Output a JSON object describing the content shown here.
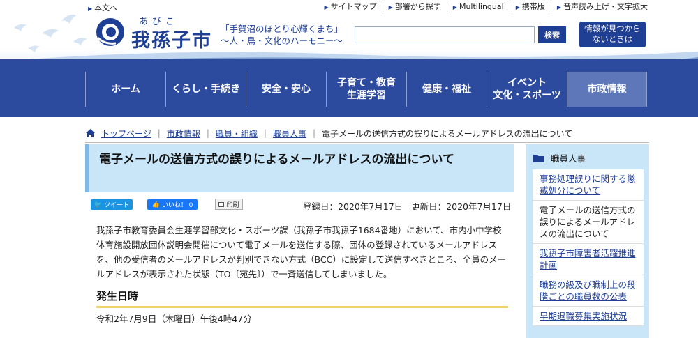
{
  "header": {
    "skip_link": "本文へ",
    "util_links": [
      "サイトマップ",
      "部署から探す",
      "Multilingual",
      "携帯版",
      "音声読み上げ・文字拡大"
    ],
    "logo_ruby": "あびこ",
    "logo_name": "我孫子市",
    "slogan_line1": "「手賀沼のほとり心輝くまち」",
    "slogan_line2": "～人・鳥・文化のハーモニー～",
    "search_value": "",
    "search_button": "検索",
    "help_line1": "情報が見つから",
    "help_line2": "ないときは"
  },
  "nav": [
    {
      "label": "ホーム"
    },
    {
      "label": "くらし・手続き"
    },
    {
      "label": "安全・安心"
    },
    {
      "label": "子育て・教育\n生涯学習"
    },
    {
      "label": "健康・福祉"
    },
    {
      "label": "イベント\n文化・スポーツ"
    },
    {
      "label": "市政情報"
    }
  ],
  "breadcrumb": {
    "items": [
      "トップページ",
      "市政情報",
      "職員・組織",
      "職員人事"
    ],
    "current": "電子メールの送信方式の誤りによるメールアドレスの流出について"
  },
  "article": {
    "title": "電子メールの送信方式の誤りによるメールアドレスの流出について",
    "tweet_label": "ツイート",
    "like_label": "いいね！ 0",
    "print_label": "印刷",
    "registered": "登録日：2020年7月17日",
    "updated": "更新日：2020年7月17日",
    "body": "我孫子市教育委員会生涯学習部文化・スポーツ課（我孫子市我孫子1684番地）において、市内小中学校体育施設開放団体説明会開催について電子メールを送信する際、団体の登録されているメールアドレスを、他の受信者のメールアドレスが判別できない方式（BCC）に設定して送信すべきところ、全員のメールアドレスが表示された状態（TO〔宛先〕）で一斉送信してしまいました。",
    "section_heading": "発生日時",
    "occurred": "令和2年7月9日（木曜日）午後4時47分"
  },
  "sidebar": {
    "heading": "職員人事",
    "items": [
      {
        "label": "事務処理誤りに関する懲戒処分について",
        "link": true
      },
      {
        "label": "電子メールの送信方式の誤りによるメールアドレスの流出について",
        "link": false
      },
      {
        "label": "我孫子市障害者活躍推進計画",
        "link": true
      },
      {
        "label": "職務の級及び職制上の段階ごとの職員数の公表",
        "link": true
      },
      {
        "label": "早期退職募集実施状況",
        "link": true
      }
    ]
  },
  "colors": {
    "brand_blue": "#1f3f95",
    "nav_bg": "#2c4a9e",
    "title_bg": "#c8e6f8",
    "heading_underline": "#f1d36a"
  },
  "icons": [
    "home-icon",
    "folder-icon",
    "print-icon",
    "city-logo-icon"
  ]
}
